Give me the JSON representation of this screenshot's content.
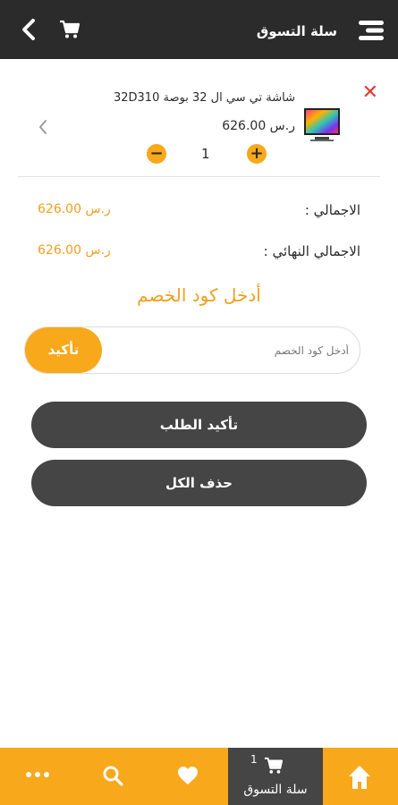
{
  "header": {
    "title": "سلة التسوق",
    "icons": {
      "menu": "menu-icon",
      "back": "chevron-left-icon",
      "cart": "cart-icon"
    }
  },
  "cart_item": {
    "name": "شاشة تي سي ال 32 بوصة 32D310",
    "price": "ر.س 626.00",
    "quantity": "1",
    "remove_glyph": "✕",
    "minus_glyph": "−",
    "plus_glyph": "+"
  },
  "totals": {
    "total_label": "الاجمالي :",
    "total_value": "ر.س 626.00",
    "final_label": "الاجمالي النهائي :",
    "final_value": "ر.س 626.00"
  },
  "coupon": {
    "title": "أدخل كود الخصم",
    "placeholder": "أدخل كود الخصم",
    "button": "تأكيد"
  },
  "actions": {
    "confirm_order": "تأكيد الطلب",
    "delete_all": "حذف الكل"
  },
  "bottom_nav": {
    "cart_label": "سلة التسوق",
    "cart_badge": "1",
    "icons": [
      "home-icon",
      "cart-icon",
      "heart-icon",
      "search-icon",
      "more-icon"
    ]
  },
  "colors": {
    "accent": "#f7a81b",
    "dark": "#2b2b2b",
    "button_dark": "#454545",
    "remove": "#e53935"
  }
}
